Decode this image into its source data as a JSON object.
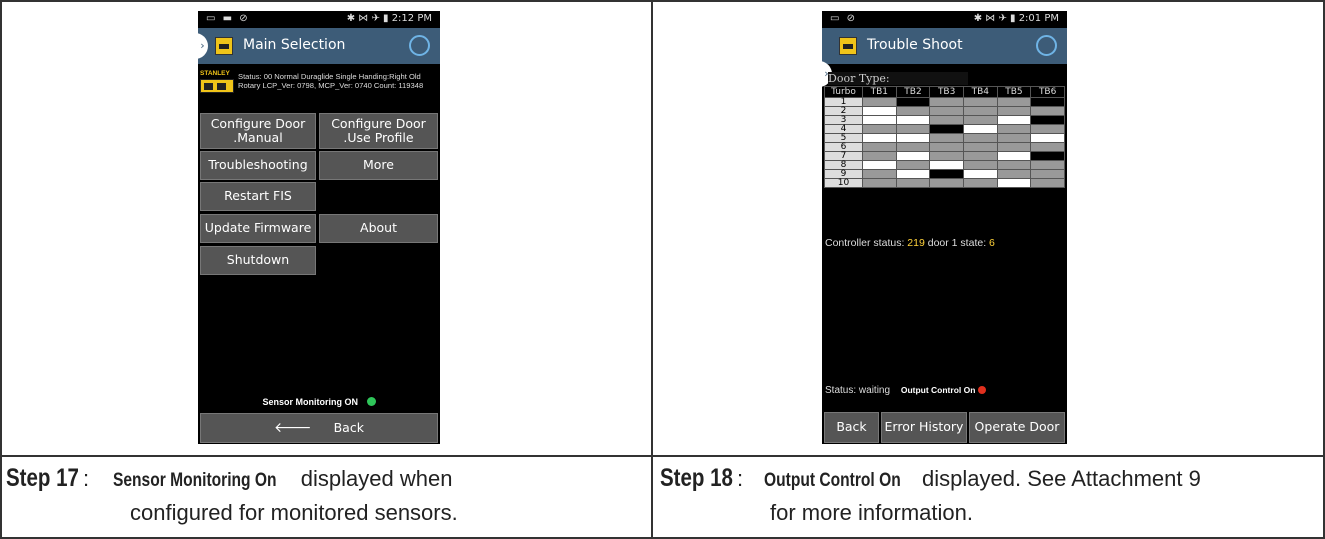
{
  "left_panel": {
    "status_bar": {
      "icons": "keyboard-icon screenshot-icon check-icon",
      "right": "✱ ⋈ ✈ ▮ 2:12 PM"
    },
    "app_title": "Main Selection",
    "info": {
      "brand": "STANLEY",
      "text": "Status: 00 Normal Duraglide Single Handing:Right Old Rotary LCP_Ver: 0798, MCP_Ver: 0740 Count: 119348"
    },
    "buttons": {
      "configure_manual": "Configure Door .Manual",
      "configure_profile": "Configure Door .Use Profile",
      "troubleshooting": "Troubleshooting",
      "more": "More",
      "restart": "Restart FIS",
      "update_firmware": "Update Firmware",
      "about": "About",
      "shutdown": "Shutdown"
    },
    "sensor_text": "Sensor Monitoring ON",
    "back": "Back",
    "caption": {
      "step": "Step 17",
      "bold": "Sensor Monitoring On",
      "line1": " displayed when",
      "line2": "configured for monitored sensors."
    }
  },
  "right_panel": {
    "status_bar": {
      "icons": "keyboard-icon check-icon",
      "right": "✱ ⋈ ✈ ▮ 2:01 PM"
    },
    "app_title": "Trouble Shoot",
    "door_type_label": "Door Type:",
    "table": {
      "headers": [
        "Turbo",
        "TB1",
        "TB2",
        "TB3",
        "TB4",
        "TB5",
        "TB6"
      ],
      "rows": [
        {
          "label": "1",
          "cells": [
            "g",
            "b",
            "g",
            "g",
            "g",
            "b"
          ]
        },
        {
          "label": "2",
          "cells": [
            "w",
            "g",
            "g",
            "g",
            "g",
            "g"
          ]
        },
        {
          "label": "3",
          "cells": [
            "w",
            "w",
            "g",
            "g",
            "w",
            "b"
          ]
        },
        {
          "label": "4",
          "cells": [
            "g",
            "g",
            "b",
            "w",
            "g",
            "g"
          ]
        },
        {
          "label": "5",
          "cells": [
            "w",
            "w",
            "g",
            "g",
            "g",
            "w"
          ]
        },
        {
          "label": "6",
          "cells": [
            "g",
            "g",
            "g",
            "g",
            "g",
            "g"
          ]
        },
        {
          "label": "7",
          "cells": [
            "g",
            "w",
            "g",
            "g",
            "w",
            "b"
          ]
        },
        {
          "label": "8",
          "cells": [
            "w",
            "g",
            "w",
            "g",
            "g",
            "g"
          ]
        },
        {
          "label": "9",
          "cells": [
            "g",
            "w",
            "b",
            "w",
            "g",
            "g"
          ]
        },
        {
          "label": "10",
          "cells": [
            "g",
            "g",
            "g",
            "g",
            "w",
            "g"
          ]
        }
      ]
    },
    "controller_status": {
      "prefix": "Controller status: ",
      "value": "219",
      "mid": " door 1 state: ",
      "state": "6"
    },
    "status_waiting": "Status: waiting",
    "output_control": "Output Control On",
    "buttons": {
      "back": "Back",
      "error_history": "Error History",
      "operate_door": "Operate Door"
    },
    "caption": {
      "step": "Step 18",
      "bold": "Output Control On",
      "line1": " displayed. See Attachment 9",
      "line2": "for more information."
    }
  },
  "colors": {
    "appbar": "#3d5c78",
    "green": "#2fc65a",
    "red": "#e0301e",
    "yellow": "#ffd23a"
  }
}
